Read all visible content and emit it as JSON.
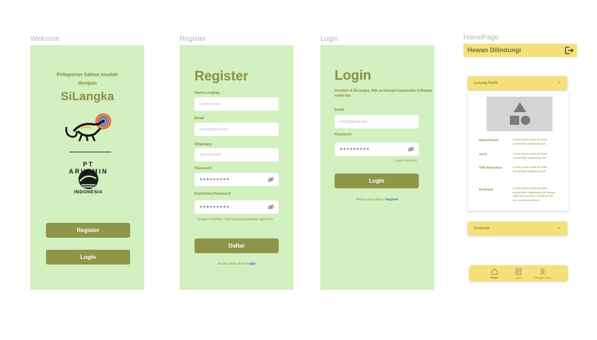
{
  "frames": {
    "welcome": "Welcome",
    "register": "Register",
    "login": "Login",
    "homepage": "HomePage"
  },
  "welcome": {
    "tagline": "Pelaporan Satwa mudah dengan",
    "app_name": "SiLangka",
    "partner_logo_text": "PT ARUTMIN",
    "partner_country": "INDONESIA",
    "register_button": "Register",
    "login_button": "Login"
  },
  "register": {
    "title": "Register",
    "fields": [
      {
        "label": "Nama Lengkap",
        "placeholder": "Lorem Ipsum"
      },
      {
        "label": "Email",
        "placeholder": "email@gmail.com"
      },
      {
        "label": "Whatsapp",
        "placeholder": "08123456789"
      },
      {
        "label": "Password",
        "placeholder": "●●●●●●●●●"
      },
      {
        "label": "Konfirmasi Password",
        "placeholder": "●●●●●●●●●"
      }
    ],
    "terms": "Dengan mendaftar, Anda menyetujui kebijakan aplikasi ini",
    "submit_button": "Daftar",
    "have_account": "Sudah punya akun?",
    "login_link": "Login"
  },
  "login": {
    "title": "Login",
    "subtitle": "Kembali di SiLangka, titik pertemuan kepedulian terhadap satwa liar.",
    "fields": [
      {
        "label": "Email",
        "placeholder": "email@gmail.com"
      },
      {
        "label": "Password",
        "placeholder": "●●●●●●●●●"
      }
    ],
    "forgot": "Lupa Password",
    "submit_button": "Login",
    "no_account": "Belum punya akun?",
    "register_link": "Register"
  },
  "home": {
    "header_title": "Hewan Dilindungi",
    "accordions": [
      {
        "title": "Lutung Putih",
        "expanded": true
      },
      {
        "title": "Komodo",
        "expanded": false
      }
    ],
    "detail_rows": [
      {
        "label": "Nama hewan",
        "value": "Lorem ipsum dolor sit amet, consectetur adipiscing elit."
      },
      {
        "label": "Jenis",
        "value": "Lorem ipsum dolor sit amet, consectetur adipiscing elit."
      },
      {
        "label": "Titik ditemukan",
        "value": "Lorem ipsum dolor sit amet, consectetur adipiscing elit."
      },
      {
        "label": "Deskripsi",
        "value": "Lorem ipsum dolor sit amet, consectetur adipiscing elit. Mauris eget risus porttitor, hendrerit nisl nec, commodo libero."
      }
    ],
    "nav": [
      {
        "label": "Home",
        "icon": "home-icon",
        "active": true
      },
      {
        "label": "Lapor",
        "icon": "report-icon",
        "active": false
      },
      {
        "label": "Petugas Baru",
        "icon": "user-badge-icon",
        "active": false
      }
    ]
  },
  "colors": {
    "screen_bg": "#d3f0c0",
    "olive": "#8f9549",
    "yellow": "#f5e07a",
    "link": "#2b6ad6"
  }
}
